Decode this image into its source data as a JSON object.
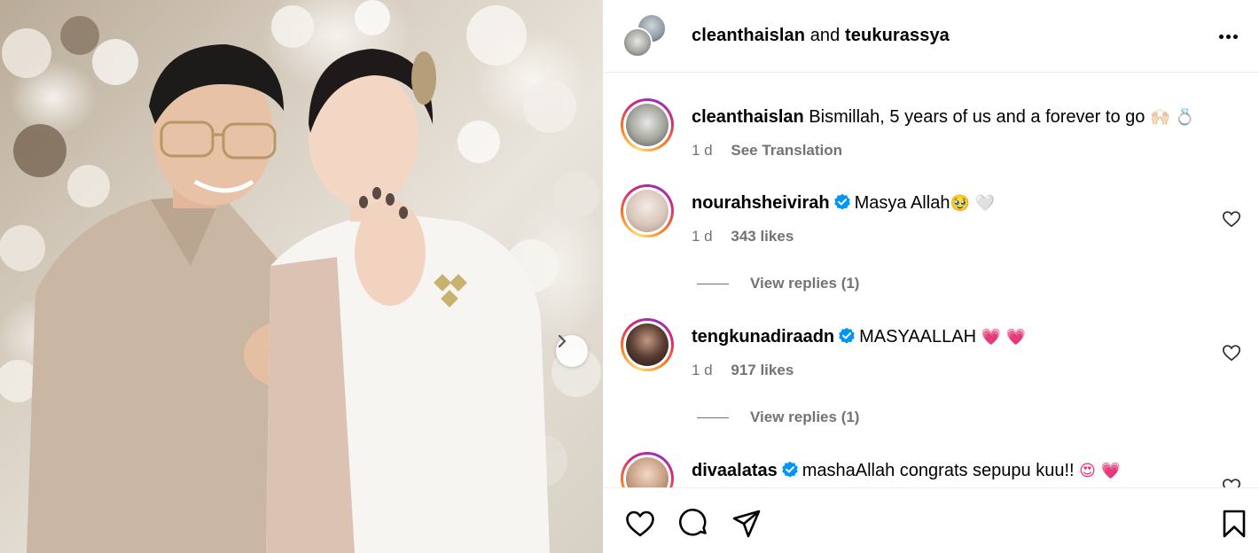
{
  "header": {
    "user1": "cleanthaislan",
    "conjunction": "and",
    "user2": "teukurassya"
  },
  "caption": {
    "username": "cleanthaislan",
    "text": "Bismillah, 5 years of us and a forever to go",
    "emojis": "🙌🏻 💍",
    "time": "1 d",
    "translate_label": "See Translation"
  },
  "comments": [
    {
      "username": "nourahsheivirah",
      "verified": true,
      "text": "Masya Allah",
      "emojis": "🥹 🤍",
      "time": "1 d",
      "likes": "343 likes",
      "replies": "View replies (1)"
    },
    {
      "username": "tengkunadiraadn",
      "verified": true,
      "text": "MASYAALLAH",
      "emojis": "💗 💗",
      "time": "1 d",
      "likes": "917 likes",
      "replies": "View replies (1)"
    },
    {
      "username": "divaalatas",
      "verified": true,
      "text": "mashaAllah congrats sepupu kuu!!",
      "emojis": "😍 💗"
    }
  ],
  "icons": {
    "more": "more-options-icon",
    "carousel_next": "chevron-right-icon",
    "like": "heart-icon",
    "comment": "comment-icon",
    "share": "share-icon",
    "save": "bookmark-icon",
    "verified": "verified-badge-icon"
  },
  "colors": {
    "verified_blue": "#0095f6",
    "meta_gray": "#737373",
    "emoji_pink": "#f0287a"
  }
}
